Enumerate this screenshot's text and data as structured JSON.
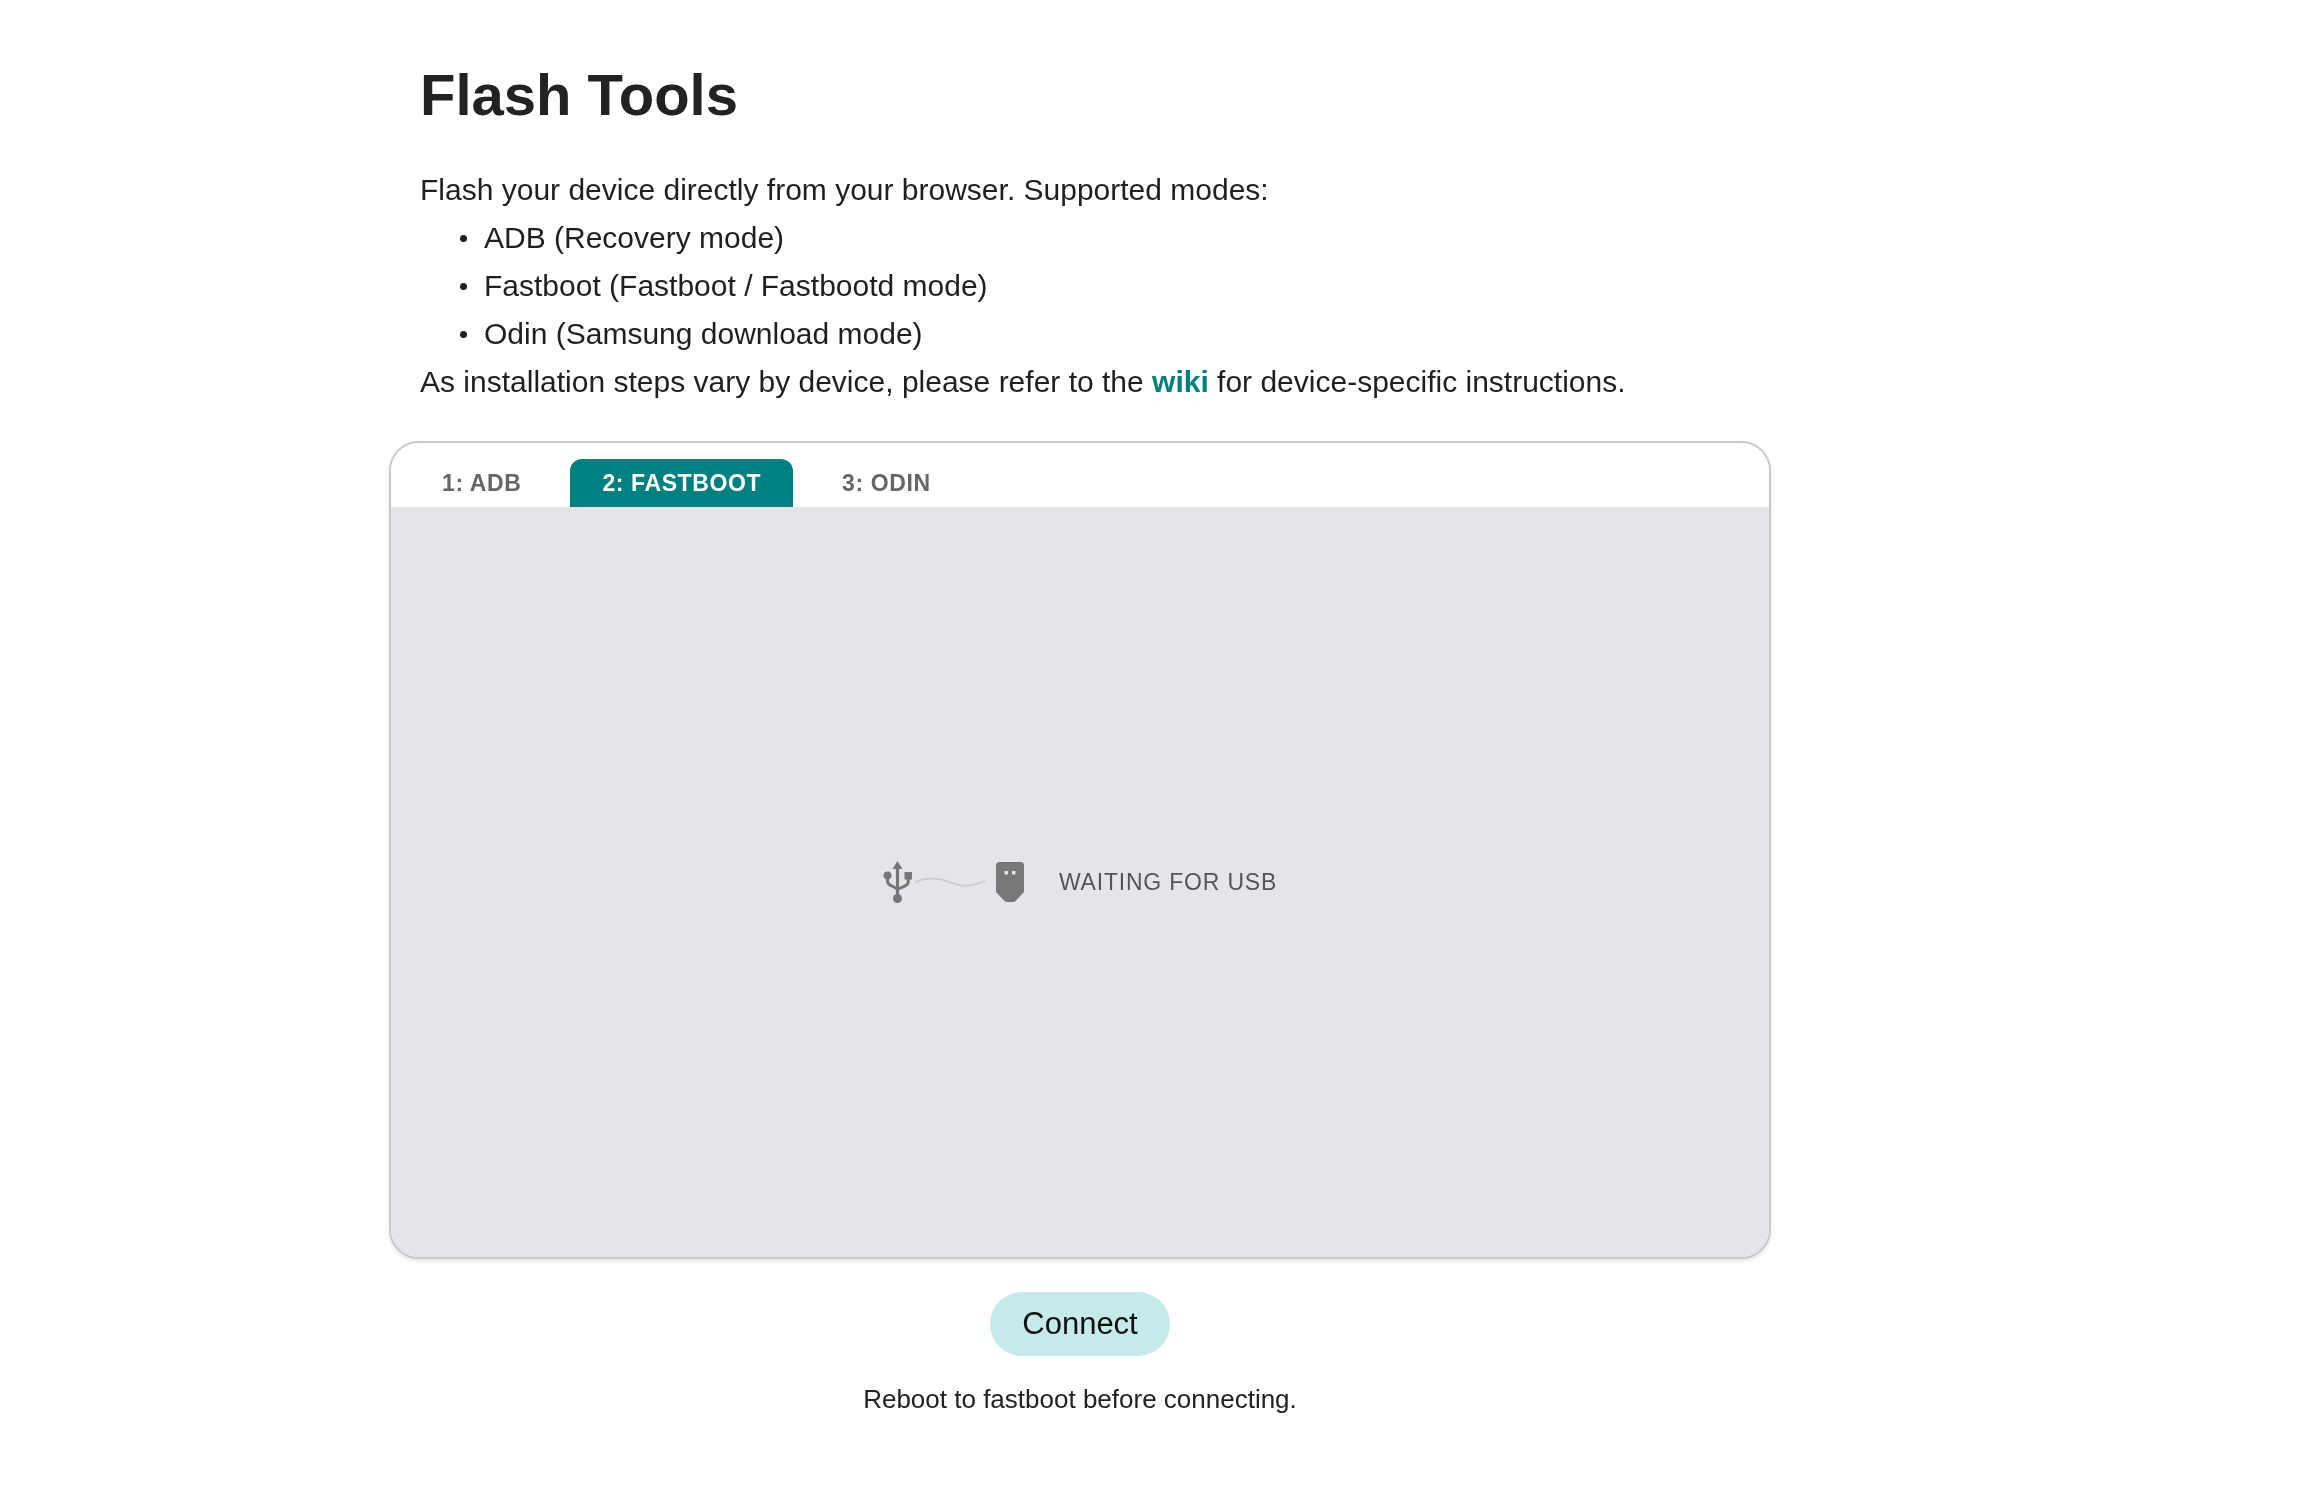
{
  "title": "Flash Tools",
  "intro": "Flash your device directly from your browser. Supported modes:",
  "modes": [
    "ADB (Recovery mode)",
    "Fastboot (Fastboot / Fastbootd mode)",
    "Odin (Samsung download mode)"
  ],
  "instructions": {
    "before": "As installation steps vary by device, please refer to the ",
    "link": "wiki",
    "after": " for device-specific instructions."
  },
  "tabs": [
    {
      "label": "1: ADB",
      "selected": false
    },
    {
      "label": "2: FASTBOOT",
      "selected": true
    },
    {
      "label": "3: ODIN",
      "selected": false
    }
  ],
  "status": "WAITING FOR USB",
  "connect_button": "Connect",
  "hint": "Reboot to fastboot before connecting."
}
